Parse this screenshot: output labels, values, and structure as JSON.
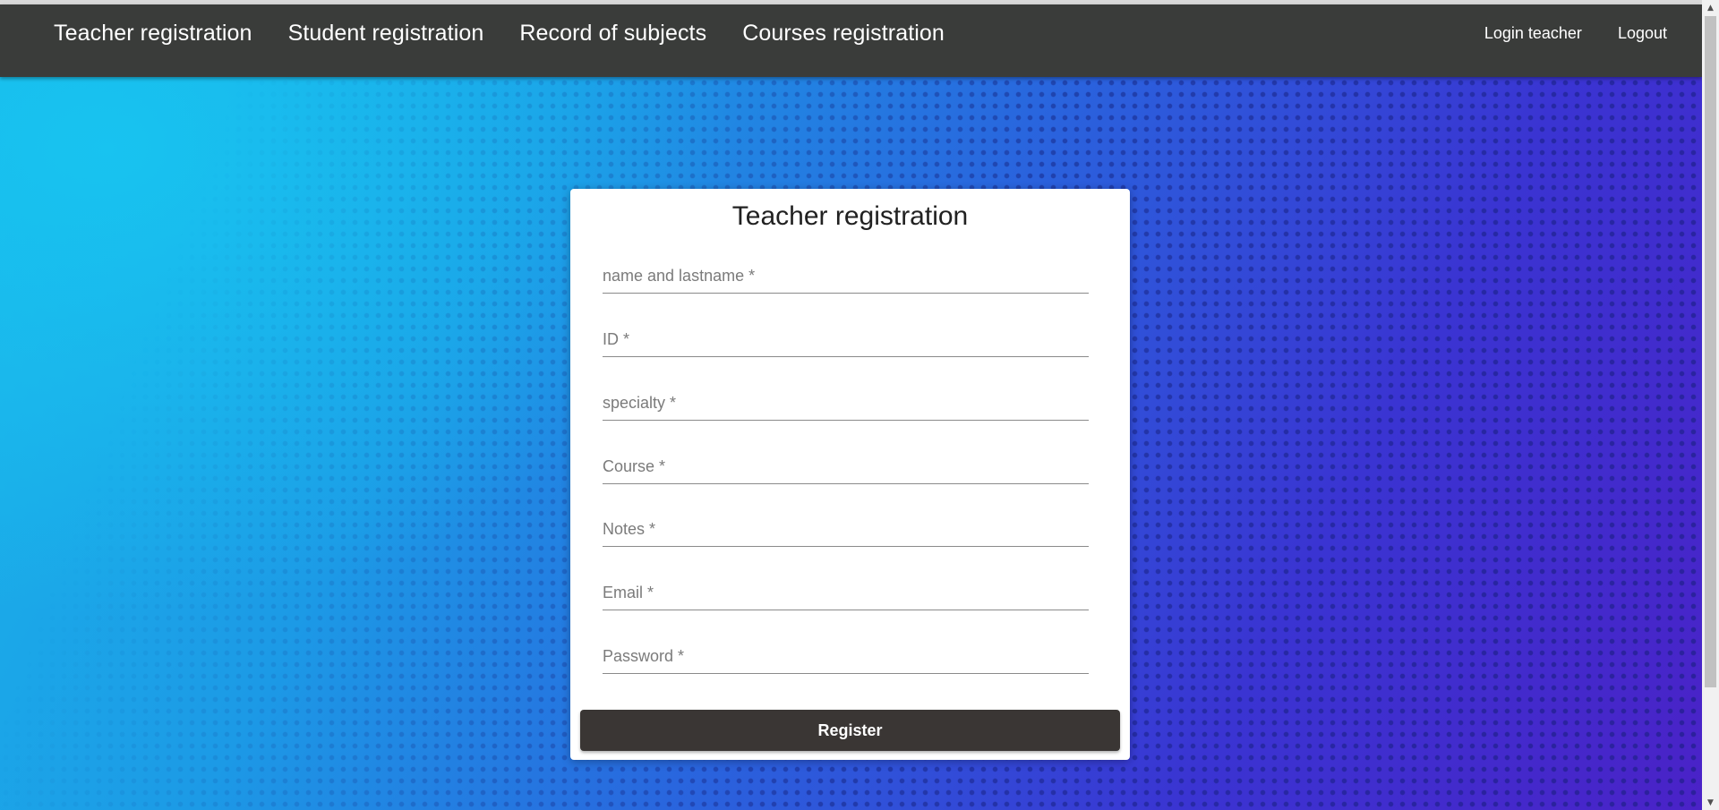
{
  "navbar": {
    "left_links": [
      {
        "label": "Teacher registration"
      },
      {
        "label": "Student registration"
      },
      {
        "label": "Record of subjects"
      },
      {
        "label": "Courses registration"
      }
    ],
    "right_links": [
      {
        "label": "Login teacher"
      },
      {
        "label": "Logout"
      }
    ]
  },
  "form": {
    "title": "Teacher registration",
    "fields": [
      {
        "placeholder": "name and lastname *",
        "value": ""
      },
      {
        "placeholder": "ID *",
        "value": ""
      },
      {
        "placeholder": "specialty *",
        "value": ""
      },
      {
        "placeholder": "Course *",
        "value": ""
      },
      {
        "placeholder": "Notes *",
        "value": ""
      },
      {
        "placeholder": "Email *",
        "value": ""
      },
      {
        "placeholder": "Password *",
        "value": ""
      }
    ],
    "submit_label": "Register"
  },
  "scrollbar": {
    "up_icon": "triangle-up-icon",
    "down_icon": "triangle-down-icon"
  },
  "colors": {
    "navbar_bg": "#3a3c3a",
    "button_bg": "#3a3634",
    "background_start": "#1ab6ea",
    "background_end": "#4a22c7"
  }
}
